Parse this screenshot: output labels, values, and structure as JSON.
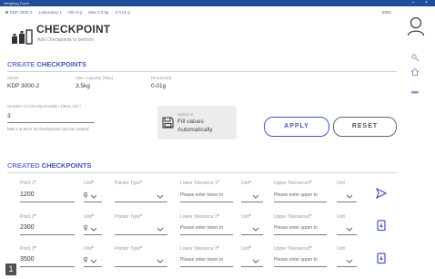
{
  "window": {
    "title": "Weighing Touch",
    "min": "–",
    "close": "×"
  },
  "topbar": {
    "device": "KDP 3000-2",
    "lab": "Laboratory 1",
    "min": "Min 0 g",
    "max": "Max 3.5 kg",
    "d": "d 0.01 g",
    "lang": "ENG"
  },
  "header": {
    "title": "CHECKPOINT",
    "subtitle": "Add Checkpoints to perform"
  },
  "create": {
    "title_light": "CREATE",
    "title_bold": "CHECKPOINTS",
    "model_label": "Model",
    "model_value": "KDP 3000-2",
    "capacity_label": "Max. Capacity (Max)",
    "capacity_value": "3.5kg",
    "readout_label": "Readout(d)",
    "readout_value": "0.01g",
    "number_label": "Number Of Checkpoints(Min 1/Max 20)",
    "number_value": "3",
    "info_text": "MIN 1 & MAX 20 checkpoints can be created",
    "fill_sub": "Select to",
    "fill_line1": "Fill values",
    "fill_line2": "Automatically",
    "apply": "APPLY",
    "reset": "RESET"
  },
  "created": {
    "title_light": "CREATED",
    "title_bold": "CHECKPOINTS",
    "rows": [
      {
        "point_label": "Point 1",
        "point": "1200",
        "unit_label": "Unit",
        "unit": "g",
        "ptype_label": "Pointer Type",
        "lower_label": "Lower Tolerance 1",
        "lower_ph": "Please enter lower to",
        "unit2_label": "Unit",
        "upper_label": "Upper Tolerance1",
        "upper_ph": "Please enter upper to",
        "unit3_label": "Unit"
      },
      {
        "point_label": "Point 2",
        "point": "2300",
        "unit_label": "Unit",
        "unit": "g",
        "ptype_label": "Pointer Type",
        "lower_label": "Lower Tolerance 2",
        "lower_ph": "Please enter lower to",
        "unit2_label": "Unit",
        "upper_label": "Upper Tolerance2",
        "upper_ph": "Please enter upper to",
        "unit3_label": "Unit"
      },
      {
        "point_label": "Point 3",
        "point": "3500",
        "unit_label": "Unit",
        "unit": "g",
        "ptype_label": "Pointer Type",
        "lower_label": "Lower Tolerance 3",
        "lower_ph": "Please enter lower to",
        "unit2_label": "Unit",
        "upper_label": "Upper Tolerance3",
        "upper_ph": "Please enter upper to",
        "unit3_label": "Unit"
      }
    ]
  },
  "page_badge": "1",
  "colors": {
    "accent": "#4356b8",
    "title_bar": "#1f4e9b",
    "required": "#e0223b"
  }
}
